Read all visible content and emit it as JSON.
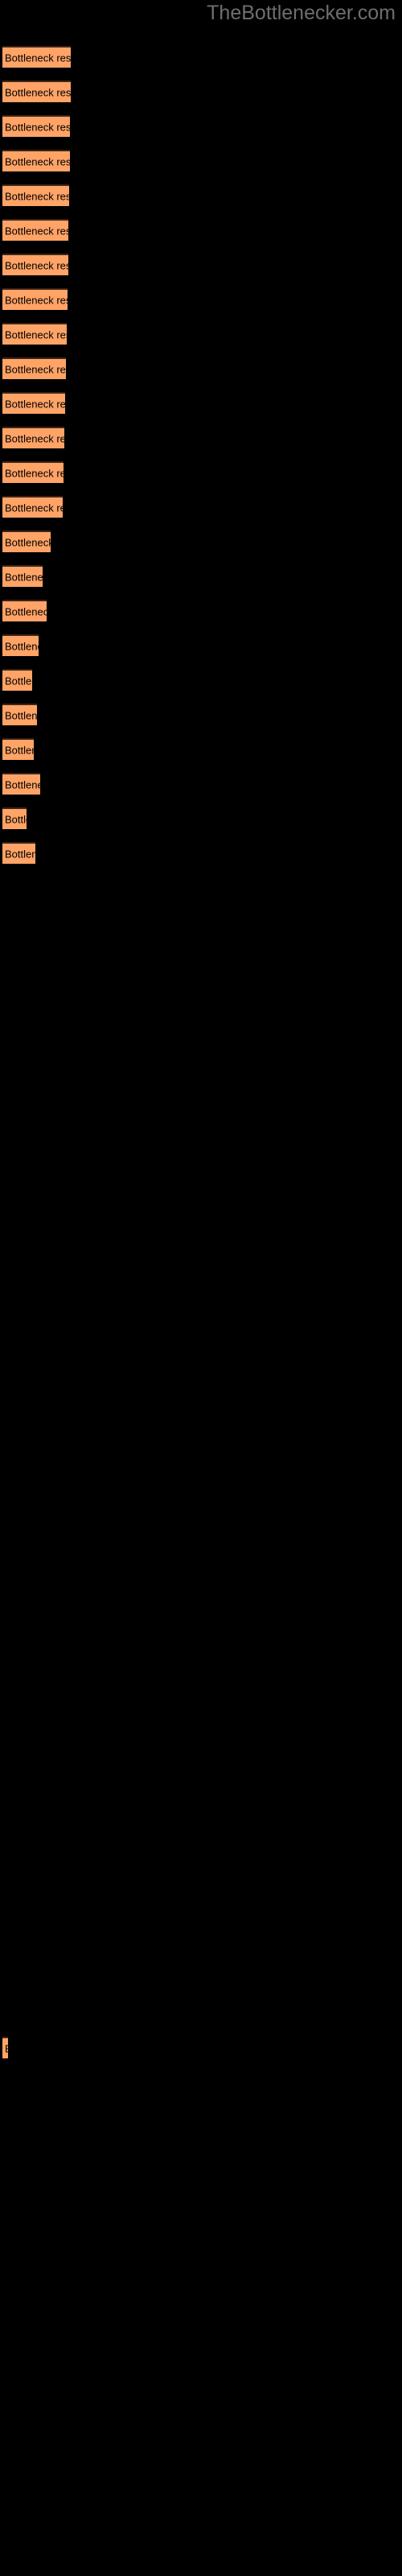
{
  "chart_title": "TheBottlenecker.com",
  "colors": {
    "background": "#000000",
    "bar_fill": "#FFA366",
    "bar_border_top": "#3d2416",
    "title_text": "#6e6e6e",
    "bar_label_text": "#000000"
  },
  "chart_data": {
    "type": "bar",
    "orientation": "horizontal",
    "title": "TheBottlenecker.com",
    "xlabel": "",
    "ylabel": "",
    "grid": false,
    "legend": null,
    "bar_label_text": "Bottleneck result",
    "categories": [
      "Bottleneck result",
      "Bottleneck result",
      "Bottleneck result",
      "Bottleneck result",
      "Bottleneck result",
      "Bottleneck result",
      "Bottleneck result",
      "Bottleneck result",
      "Bottleneck result",
      "Bottleneck result",
      "Bottleneck result",
      "Bottleneck result",
      "Bottleneck result",
      "Bottleneck result",
      "Bottleneck result",
      "Bottleneck result",
      "Bottleneck result",
      "Bottleneck result",
      "Bottleneck result",
      "Bottleneck result",
      "Bottleneck result",
      "Bottleneck result",
      "Bottleneck result"
    ],
    "values": [
      85,
      85,
      84,
      84,
      83,
      82,
      82,
      81,
      80,
      79,
      78,
      77,
      76,
      75,
      60,
      50,
      55,
      45,
      37,
      43,
      39,
      47,
      30,
      41,
      7
    ],
    "xlim": [
      0,
      500
    ],
    "bars": [
      {
        "index": 1,
        "label": "Bottleneck result",
        "width": 85,
        "y": 57
      },
      {
        "index": 2,
        "label": "Bottleneck result",
        "width": 85,
        "y": 100
      },
      {
        "index": 3,
        "label": "Bottleneck result",
        "width": 84,
        "y": 143
      },
      {
        "index": 4,
        "label": "Bottleneck result",
        "width": 84,
        "y": 186
      },
      {
        "index": 5,
        "label": "Bottleneck result",
        "width": 83,
        "y": 229
      },
      {
        "index": 6,
        "label": "Bottleneck result",
        "width": 82,
        "y": 272
      },
      {
        "index": 7,
        "label": "Bottleneck result",
        "width": 82,
        "y": 315
      },
      {
        "index": 8,
        "label": "Bottleneck result",
        "width": 81,
        "y": 358
      },
      {
        "index": 9,
        "label": "Bottleneck result",
        "width": 80,
        "y": 401
      },
      {
        "index": 10,
        "label": "Bottleneck result",
        "width": 79,
        "y": 444
      },
      {
        "index": 11,
        "label": "Bottleneck result",
        "width": 78,
        "y": 487
      },
      {
        "index": 12,
        "label": "Bottleneck result",
        "width": 77,
        "y": 530
      },
      {
        "index": 13,
        "label": "Bottleneck result",
        "width": 76,
        "y": 573
      },
      {
        "index": 14,
        "label": "Bottleneck result",
        "width": 75,
        "y": 616
      },
      {
        "index": 15,
        "label": "Bottleneck result",
        "width": 60,
        "y": 659
      },
      {
        "index": 16,
        "label": "Bottleneck result",
        "width": 50,
        "y": 702
      },
      {
        "index": 17,
        "label": "Bottleneck result",
        "width": 55,
        "y": 745
      },
      {
        "index": 18,
        "label": "Bottleneck result",
        "width": 45,
        "y": 788
      },
      {
        "index": 19,
        "label": "Bottleneck result",
        "width": 37,
        "y": 831
      },
      {
        "index": 20,
        "label": "Bottleneck result",
        "width": 43,
        "y": 874
      },
      {
        "index": 21,
        "label": "Bottleneck result",
        "width": 39,
        "y": 917
      },
      {
        "index": 22,
        "label": "Bottleneck result",
        "width": 47,
        "y": 960
      },
      {
        "index": 23,
        "label": "Bottleneck result",
        "width": 30,
        "y": 1003
      },
      {
        "index": 24,
        "label": "Bottleneck result",
        "width": 41,
        "y": 1046
      },
      {
        "index": 25,
        "label": "Bottleneck result",
        "width": 7,
        "y": 2530
      }
    ]
  }
}
